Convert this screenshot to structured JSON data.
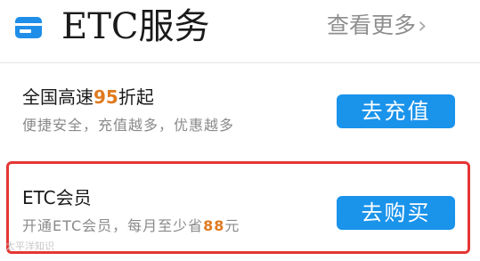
{
  "header": {
    "title": "ETC服务",
    "more_label": "查看更多",
    "more_chevron": "chevron-right-icon",
    "icon": "card-icon"
  },
  "services": [
    {
      "title_pre": "全国高速",
      "title_highlight": "95",
      "title_post": "折起",
      "subtitle": "便捷安全，充值越多，优惠越多",
      "button_label": "去充值"
    },
    {
      "title": "ETC会员",
      "subtitle_pre": "开通ETC会员，每月至少省",
      "subtitle_highlight": "88",
      "subtitle_post": "元",
      "button_label": "去购买",
      "highlighted": true
    }
  ],
  "watermark": "太平洋知识",
  "colors": {
    "accent_blue": "#1a93eb",
    "highlight_orange": "#e07a1f",
    "highlight_border": "#e53636",
    "text_gray": "#8a8a8a"
  }
}
